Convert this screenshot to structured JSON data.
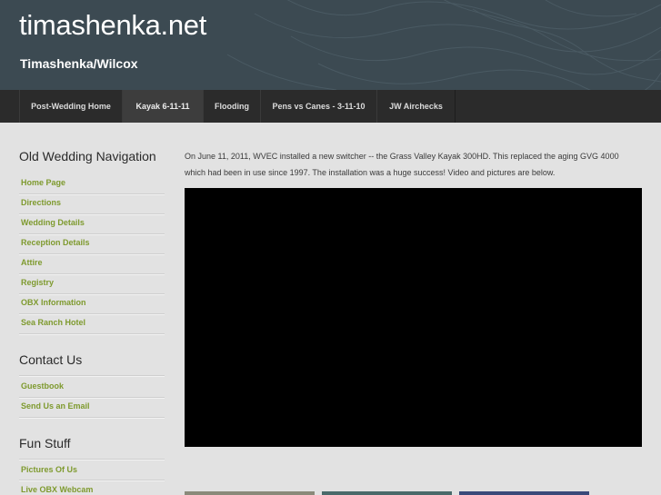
{
  "site": {
    "title": "timashenka.net",
    "tagline": "Timashenka/Wilcox"
  },
  "nav": {
    "items": [
      {
        "label": "Post-Wedding Home",
        "active": false
      },
      {
        "label": "Kayak 6-11-11",
        "active": true
      },
      {
        "label": "Flooding",
        "active": false
      },
      {
        "label": "Pens vs Canes - 3-11-10",
        "active": false
      },
      {
        "label": "JW Airchecks",
        "active": false
      }
    ]
  },
  "sidebar": {
    "wedding_heading": "Old Wedding Navigation",
    "wedding_links": [
      "Home Page",
      "Directions",
      "Wedding Details",
      "Reception Details",
      "Attire",
      "Registry",
      "OBX Information",
      "Sea Ranch Hotel"
    ],
    "contact_heading": "Contact Us",
    "contact_links": [
      "Guestbook",
      "Send Us an Email"
    ],
    "fun_heading": "Fun Stuff",
    "fun_links": [
      "Pictures Of Us",
      "Live OBX Webcam"
    ]
  },
  "main": {
    "intro": "On June 11, 2011, WVEC installed a new switcher -- the Grass Valley Kayak 300HD. This replaced the aging GVG 4000 which had been in use since 1997. The installation was a huge success! Video and pictures are below."
  },
  "colors": {
    "header_bg": "#3c4a52",
    "nav_bg": "#2b2b2b",
    "link": "#7e9a2e",
    "page_bg": "#e2e2e2"
  }
}
